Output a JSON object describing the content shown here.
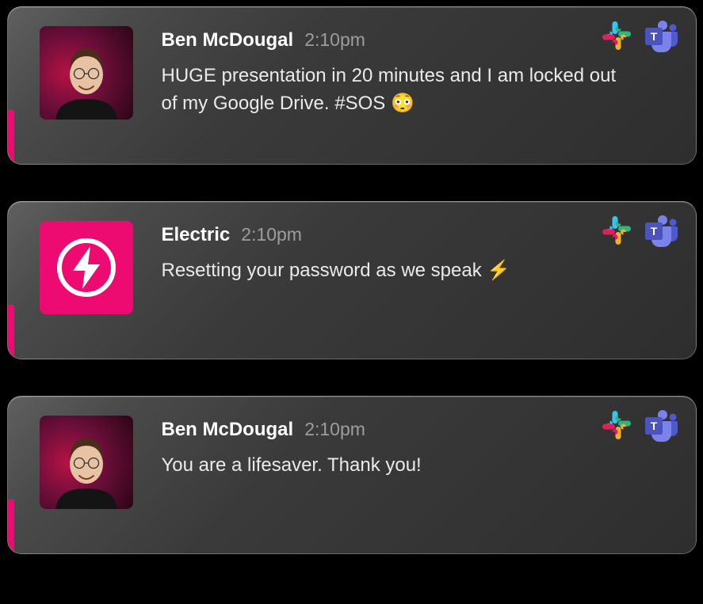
{
  "colors": {
    "accent": "#ed0b71",
    "card_bg_start": "#5f5f5f",
    "card_bg_end": "#2e2e2e",
    "text": "#eaeaea",
    "muted": "#9d9d9d"
  },
  "messages": [
    {
      "author": "Ben McDougal",
      "time": "2:10pm",
      "body": "HUGE presentation in 20 minutes and I am locked out of my Google Drive. #SOS 😳",
      "avatar_type": "human",
      "channels": [
        "slack",
        "teams"
      ]
    },
    {
      "author": "Electric",
      "time": "2:10pm",
      "body": "Resetting your password as we speak ⚡",
      "avatar_type": "app",
      "channels": [
        "slack",
        "teams"
      ]
    },
    {
      "author": "Ben McDougal",
      "time": "2:10pm",
      "body": "You are a lifesaver. Thank you!",
      "avatar_type": "human",
      "channels": [
        "slack",
        "teams"
      ]
    }
  ]
}
